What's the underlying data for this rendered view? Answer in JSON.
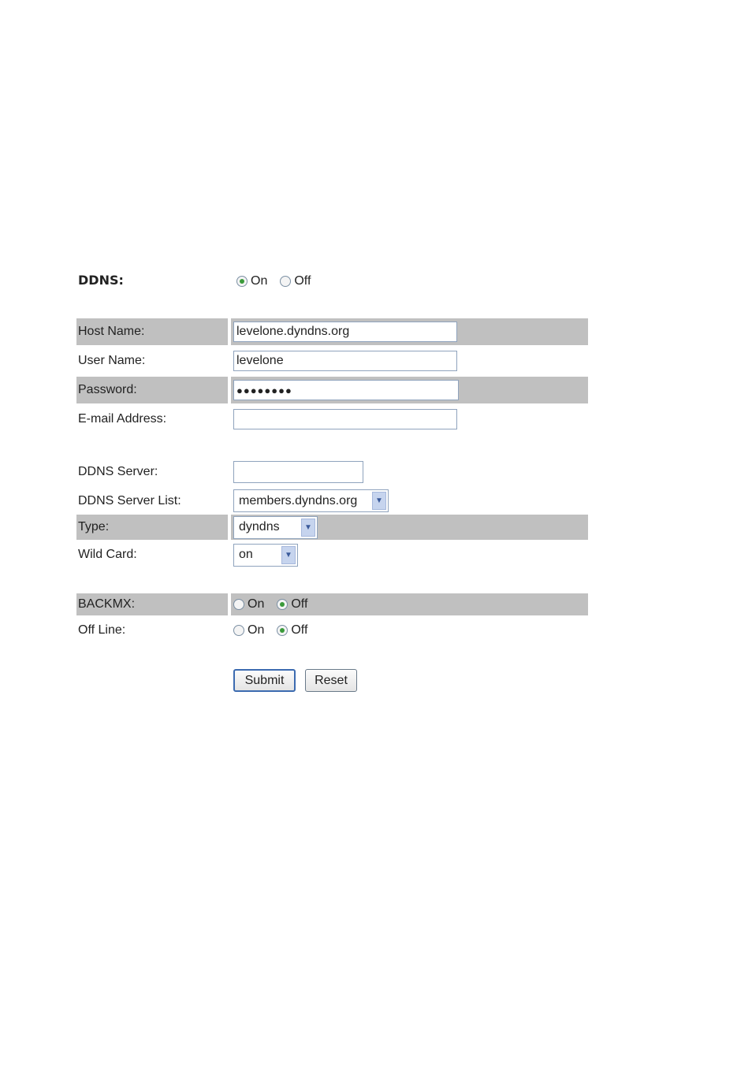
{
  "ddns": {
    "label": "DDNS:",
    "options": [
      {
        "label": "On",
        "selected": true
      },
      {
        "label": "Off",
        "selected": false
      }
    ]
  },
  "fields": {
    "host_name": {
      "label": "Host Name:",
      "value": "levelone.dyndns.org"
    },
    "user_name": {
      "label": "User Name:",
      "value": "levelone"
    },
    "password": {
      "label": "Password:",
      "value": "●●●●●●●●"
    },
    "email": {
      "label": "E-mail Address:",
      "value": ""
    },
    "ddns_server": {
      "label": "DDNS Server:",
      "value": ""
    },
    "ddns_server_list": {
      "label": "DDNS Server List:",
      "value": "members.dyndns.org"
    },
    "type": {
      "label": "Type:",
      "value": "dyndns"
    },
    "wild_card": {
      "label": "Wild Card:",
      "value": "on"
    }
  },
  "backmx": {
    "label": "BACKMX:",
    "options": [
      {
        "label": "On",
        "selected": false
      },
      {
        "label": "Off",
        "selected": true
      }
    ]
  },
  "offline": {
    "label": "Off Line:",
    "options": [
      {
        "label": "On",
        "selected": false
      },
      {
        "label": "Off",
        "selected": true
      }
    ]
  },
  "buttons": {
    "submit": "Submit",
    "reset": "Reset"
  },
  "colors": {
    "row_gray": "#c0c0c0",
    "radio_dot": "#3a9a3a",
    "input_border": "#8fa3bd"
  }
}
